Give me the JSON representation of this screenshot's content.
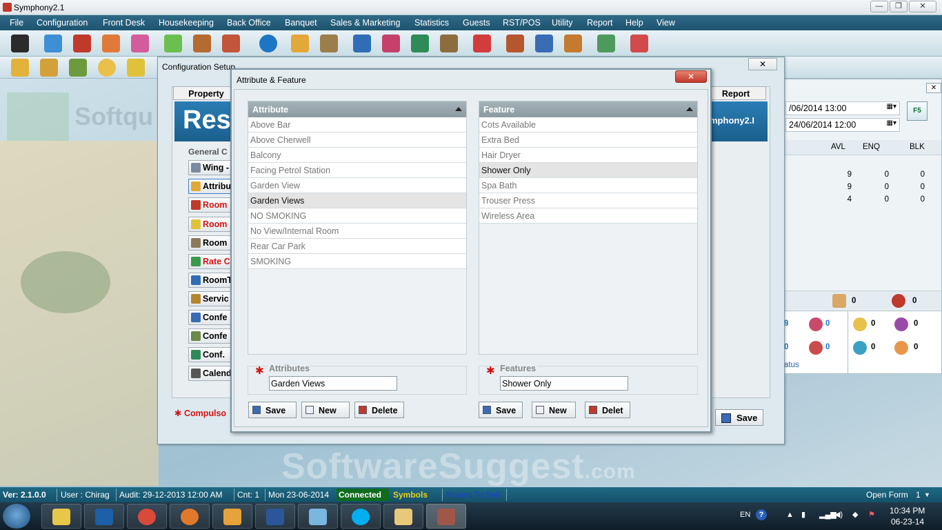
{
  "window": {
    "title": "Symphony2.1"
  },
  "menu": [
    "File",
    "Configuration",
    "Front Desk",
    "Housekeeping",
    "Back Office",
    "Banquet",
    "Sales & Marketing",
    "Statistics",
    "Guests",
    "RST/POS",
    "Utility",
    "Report",
    "Help",
    "View"
  ],
  "config_window": {
    "title": "Configuration Setup",
    "tab_property": "Property",
    "tab_report": "Report",
    "banner_text": "Res",
    "banner_right": "mphony2.I",
    "general": "General C",
    "buttons": [
      "Wing -",
      "Attribu",
      "Room",
      "Room",
      "Room",
      "Rate C",
      "RoomT",
      "Servic",
      "Confe",
      "Confe",
      "Conf.",
      "Calend"
    ],
    "compulsory": "Compulso",
    "save": "Save"
  },
  "dialog": {
    "title": "Attribute & Feature",
    "attribute_header": "Attribute",
    "feature_header": "Feature",
    "attributes": [
      "Above Bar",
      "Above Cherwell",
      "Balcony",
      "Facing Petrol Station",
      "Garden View",
      "Garden Views",
      "NO SMOKING",
      "No View/Internal Room",
      "Rear Car Park",
      "SMOKING"
    ],
    "selected_attribute": "Garden Views",
    "features": [
      "Cots Available",
      "Extra Bed",
      "Hair Dryer",
      "Shower Only",
      "Spa Bath",
      "Trouser Press",
      "Wireless Area"
    ],
    "selected_feature": "Shower Only",
    "attributes_label": "Attributes",
    "features_label": "Features",
    "attribute_value": "Garden Views",
    "feature_value": "Shower Only",
    "save": "Save",
    "new": "New",
    "delete": "Delete",
    "delete_feature": "Delet"
  },
  "right_panel": {
    "date_from": "/06/2014 13:00",
    "date_to": "24/06/2014 12:00",
    "f5": "F5",
    "cols": [
      "AVL",
      "ENQ",
      "BLK"
    ],
    "rows": [
      [
        "9",
        "0",
        "0"
      ],
      [
        "9",
        "0",
        "0"
      ],
      [
        "4",
        "0",
        "0"
      ]
    ],
    "footer_vals": [
      "0",
      "0"
    ],
    "symbol_vals": [
      "9",
      "0",
      "0",
      "0",
      "0",
      "0",
      "0",
      "0"
    ],
    "status_text": "atus"
  },
  "watermark": {
    "text": "SoftwareSuggest",
    "suffix": ".com",
    "left_brand": "Softqu"
  },
  "statusbar": {
    "version": "Ver: 2.1.0.0",
    "user": "User : Chirag",
    "audit": "Audit: 29-12-2013 12:00 AM",
    "cnt": "Cnt: 1",
    "date": "Mon 23-06-2014",
    "connected": "Connected",
    "symbols": "Symbols",
    "rooms": "Rooms To Sell",
    "open_form": "Open Form",
    "open_count": "1"
  },
  "taskbar": {
    "lang": "EN",
    "time": "10:34 PM",
    "date": "06-23-14"
  },
  "colors": {
    "menu_bg": "#1d5470",
    "banner": "#2a7db4",
    "required": "#d41414",
    "connected": "#0f6b1e",
    "symbols": "#e6d21a"
  }
}
